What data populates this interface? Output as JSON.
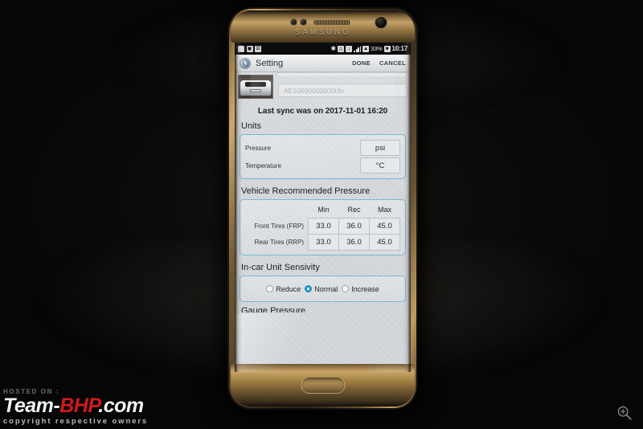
{
  "statusbar": {
    "left_icons": [
      "mute-icon",
      "screenshot-icon",
      "no-entry-icon"
    ],
    "right_icons": [
      "bluetooth-icon",
      "wifi-icon",
      "data-saver-icon",
      "signal-bars-icon",
      "sim-signal-icon"
    ],
    "bluetooth_glyph": "✱",
    "battery_text": "33%",
    "battery_icon": "battery-icon",
    "time": "10:17"
  },
  "titlebar": {
    "app_icon": "tyre-gauge-logo-icon",
    "title": "Setting",
    "done_label": "DONE",
    "cancel_label": "CANCEL"
  },
  "vehicle": {
    "thumbnail": "bmw-car-photo",
    "id_value": "AE10690000000I3n"
  },
  "sync": {
    "text": "Last sync was on 2017-11-01 16:20"
  },
  "units": {
    "section_title": "Units",
    "rows": [
      {
        "label": "Pressure",
        "value": "psi"
      },
      {
        "label": "Temperature",
        "value": "°C"
      }
    ]
  },
  "recommended_pressure": {
    "section_title": "Vehicle Recommended Pressure",
    "columns": [
      "Min",
      "Rec",
      "Max"
    ],
    "rows": [
      {
        "label": "Front Tires (FRP)",
        "values": [
          "33.0",
          "36.0",
          "45.0"
        ]
      },
      {
        "label": "Rear Tires (RRP)",
        "values": [
          "33.0",
          "36.0",
          "45.0"
        ]
      }
    ]
  },
  "sensivity": {
    "section_title": "In-car Unit Sensivity",
    "options": [
      {
        "label": "Reduce",
        "selected": false
      },
      {
        "label": "Normal",
        "selected": true
      },
      {
        "label": "Increase",
        "selected": false
      }
    ],
    "selected_color": "#1e93c4"
  },
  "next_section": {
    "title": "Gauge Pressure"
  },
  "phone": {
    "brand": "SAMSUNG"
  },
  "watermark": {
    "hosted_on": "HOSTED ON :",
    "team": "Team-",
    "bhp": "BHP",
    "com": ".com",
    "copyright": "copyright respective owners",
    "accent_color": "#d31a1a"
  }
}
